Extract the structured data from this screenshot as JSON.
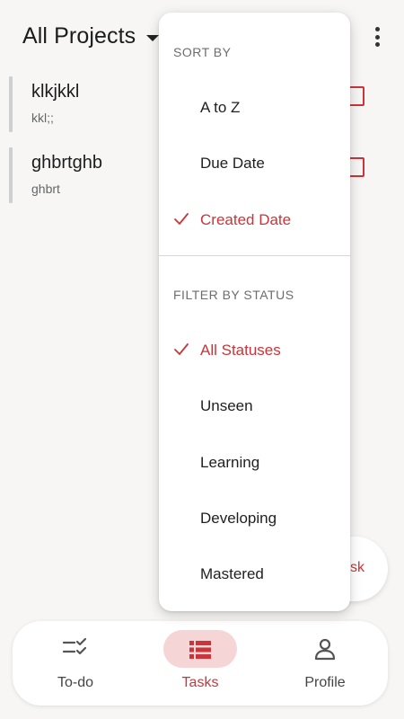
{
  "header": {
    "project_title": "All Projects",
    "caret_icon": "caret-down-icon",
    "more_icon": "more-vertical-icon"
  },
  "tasks": [
    {
      "title": "klkjkkl",
      "subtitle": "kkl;;"
    },
    {
      "title": "ghbrtghb",
      "subtitle": "ghbrt"
    }
  ],
  "fab": {
    "label_visible": "sk"
  },
  "menu": {
    "sort_header": "SORT BY",
    "sort_options": [
      {
        "label": "A to Z",
        "selected": false
      },
      {
        "label": "Due Date",
        "selected": false
      },
      {
        "label": "Created Date",
        "selected": true
      }
    ],
    "filter_header": "FILTER BY STATUS",
    "filter_options": [
      {
        "label": "All Statuses",
        "selected": true
      },
      {
        "label": "Unseen",
        "selected": false
      },
      {
        "label": "Learning",
        "selected": false
      },
      {
        "label": "Developing",
        "selected": false
      },
      {
        "label": "Mastered",
        "selected": false
      }
    ]
  },
  "bottom_nav": {
    "items": [
      {
        "label": "To-do",
        "icon": "todo-checklist-icon",
        "active": false
      },
      {
        "label": "Tasks",
        "icon": "tasks-list-icon",
        "active": true
      },
      {
        "label": "Profile",
        "icon": "profile-person-icon",
        "active": false
      }
    ]
  },
  "colors": {
    "accent": "#c8353a",
    "active_pill": "#f6d5d6",
    "background": "#f7f6f4",
    "surface": "#ffffff"
  }
}
